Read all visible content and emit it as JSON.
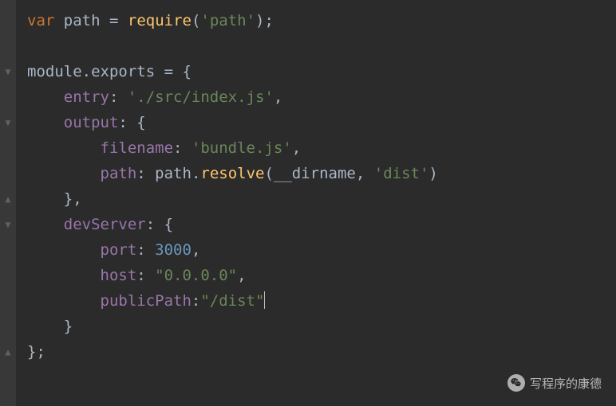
{
  "gutter": [
    "",
    "",
    "▼",
    "",
    "▼",
    "",
    "",
    "▲",
    "▼",
    "",
    "",
    "",
    "",
    "▲",
    ""
  ],
  "tok": {
    "var": "var",
    "path": "path",
    "eq": " = ",
    "require": "require",
    "lp": "(",
    "rp": ")",
    "sc": ";",
    "s_path": "'path'",
    "module": "module",
    "dot": ".",
    "exports": "exports",
    "lb": "{",
    "rb": "}",
    "entry": "entry",
    "col": ": ",
    "s_entry": "'./src/index.js'",
    "cm": ",",
    "output": "output",
    "filename": "filename",
    "s_bundle": "'bundle.js'",
    "pathProp": "path",
    "resolve": "resolve",
    "dirname": "__dirname",
    "csep": ", ",
    "s_dist": "'dist'",
    "devServer": "devServer",
    "port": "port",
    "n3000": "3000",
    "host": "host",
    "s_host": "\"0.0.0.0\"",
    "publicPath": "publicPath",
    "colTight": ":",
    "s_pubdist": "\"/dist\""
  },
  "watermark": "写程序的康德"
}
